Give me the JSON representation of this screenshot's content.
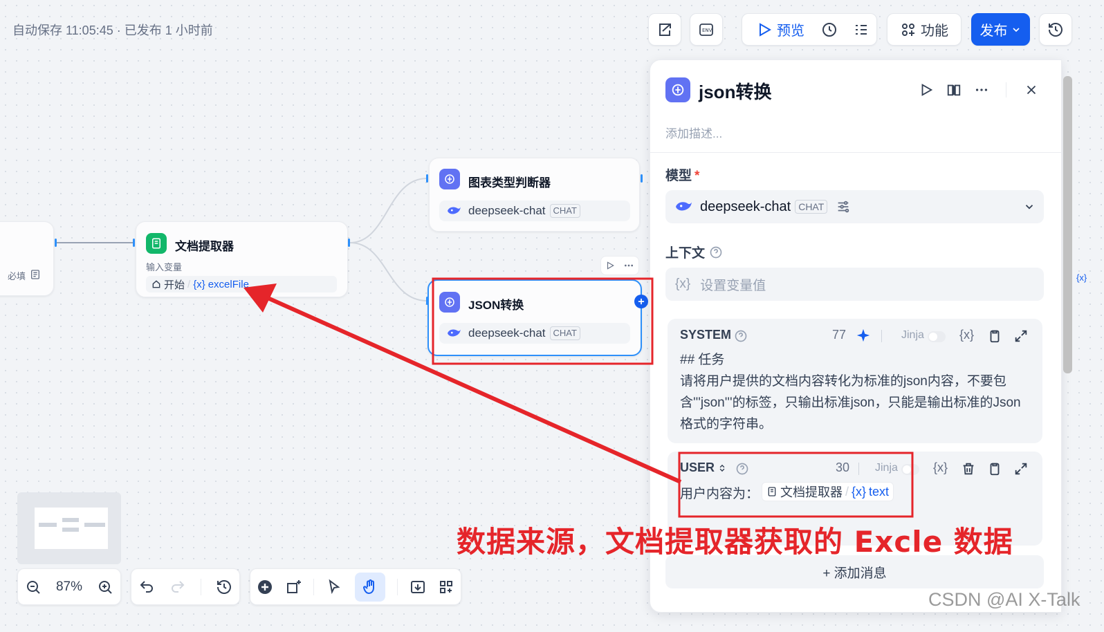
{
  "status": {
    "autosave": "自动保存 11:05:45 · 已发布 1 小时前"
  },
  "toolbar": {
    "preview_label": "预览",
    "features_label": "功能",
    "publish_label": "发布"
  },
  "canvas": {
    "start_node": {
      "required_label": "必填"
    },
    "doc_node": {
      "title": "文档提取器",
      "input_label": "输入变量",
      "source": "开始",
      "sep": "/",
      "var_prefix": "{x}",
      "var_name": "excelFile"
    },
    "chart_node": {
      "title": "图表类型判断器",
      "model": "deepseek-chat",
      "tag": "CHAT"
    },
    "json_node": {
      "title": "JSON转换",
      "model": "deepseek-chat",
      "tag": "CHAT"
    },
    "minimap": {},
    "zoom": "87%"
  },
  "panel": {
    "title": "json转换",
    "description_placeholder": "添加描述...",
    "model_label": "模型",
    "required_mark": "*",
    "model_name": "deepseek-chat",
    "model_tag": "CHAT",
    "context_label": "上下文",
    "context_placeholder": "设置变量值",
    "system": {
      "role": "SYSTEM",
      "count": "77",
      "jinja": "Jinja",
      "line1": "## 任务",
      "line2": "请将用户提供的文档内容转化为标准的json内容，不要包含'''json'''的标签，只输出标准json，只能是输出标准的Json格式的字符串。"
    },
    "user": {
      "role": "USER",
      "count": "30",
      "jinja": "Jinja",
      "prefix": "用户内容为：",
      "node": "文档提取器",
      "sep": "/",
      "var_prefix": "{x}",
      "var_name": "text"
    },
    "add_message": "+ 添加消息",
    "xbadge": "{x}"
  },
  "annotation": {
    "text": "数据来源，文档提取器获取的 Excle 数据"
  },
  "watermark": {
    "text": "CSDN @AI X-Talk"
  },
  "colors": {
    "accent": "#155eef",
    "llm": "#6172f3",
    "doc": "#12b76a",
    "annotation": "#e5252a"
  }
}
